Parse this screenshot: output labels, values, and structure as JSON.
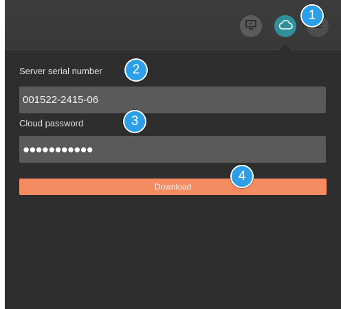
{
  "toolbar": {
    "icons": [
      "monitor-icon",
      "cloud-icon",
      "menu-icon"
    ],
    "active_tab": "cloud"
  },
  "form": {
    "serial_label": "Server serial number",
    "serial_value": "001522-2415-06",
    "password_label": "Cloud password",
    "password_value": "●●●●●●●●●●●",
    "download_label": "Download"
  },
  "callouts": {
    "c1": "1",
    "c2": "2",
    "c3": "3",
    "c4": "4"
  },
  "colors": {
    "panel_background": "#2e2e2e",
    "topbar_background": "#3a3a3a",
    "active_icon": "#2f8f9a",
    "field_background": "#5a5a5a",
    "download_button": "#f58b61",
    "callout": "#2ba0e8"
  }
}
